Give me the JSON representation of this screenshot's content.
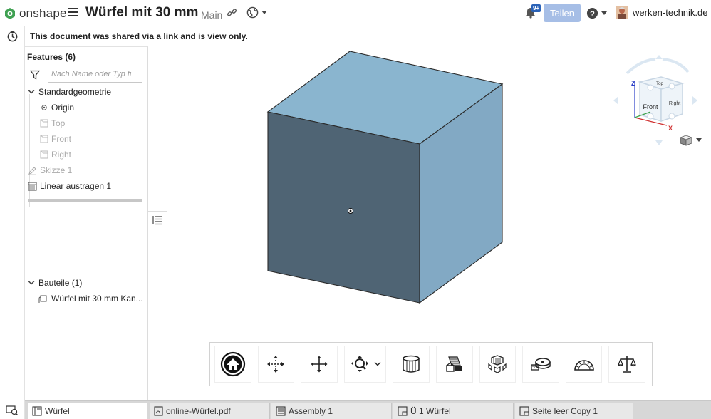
{
  "topbar": {
    "brand": "onshape",
    "doc_title": "Würfel mit 30 mm",
    "workspace": "Main",
    "notification_badge": "9+",
    "share_label": "Teilen",
    "user_name": "werken-technik.de"
  },
  "banner": {
    "text": "This document was shared via a link and is view only."
  },
  "features": {
    "title": "Features (6)",
    "search_placeholder": "Nach Name oder Typ fi",
    "group": "Standardgeometrie",
    "items": [
      {
        "label": "Origin"
      },
      {
        "label": "Top"
      },
      {
        "label": "Front"
      },
      {
        "label": "Right"
      },
      {
        "label": "Skizze 1"
      },
      {
        "label": "Linear austragen 1"
      }
    ]
  },
  "parts": {
    "title": "Bauteile (1)",
    "items": [
      {
        "label": "Würfel mit 30 mm Kan..."
      }
    ]
  },
  "viewcube": {
    "top": "Top",
    "front": "Front",
    "right": "Right",
    "axis_z": "Z",
    "axis_x": "X"
  },
  "tabs": [
    {
      "label": "Würfel"
    },
    {
      "label": "online-Würfel.pdf"
    },
    {
      "label": "Assembly 1"
    },
    {
      "label": "Ü 1 Würfel"
    },
    {
      "label": "Seite leer Copy 1"
    }
  ],
  "colors": {
    "cube_top": "#8ab5cf",
    "cube_front": "#4f6474",
    "cube_right": "#82a9c4",
    "share_button": "#a6bee6",
    "badge": "#2a62b7"
  }
}
